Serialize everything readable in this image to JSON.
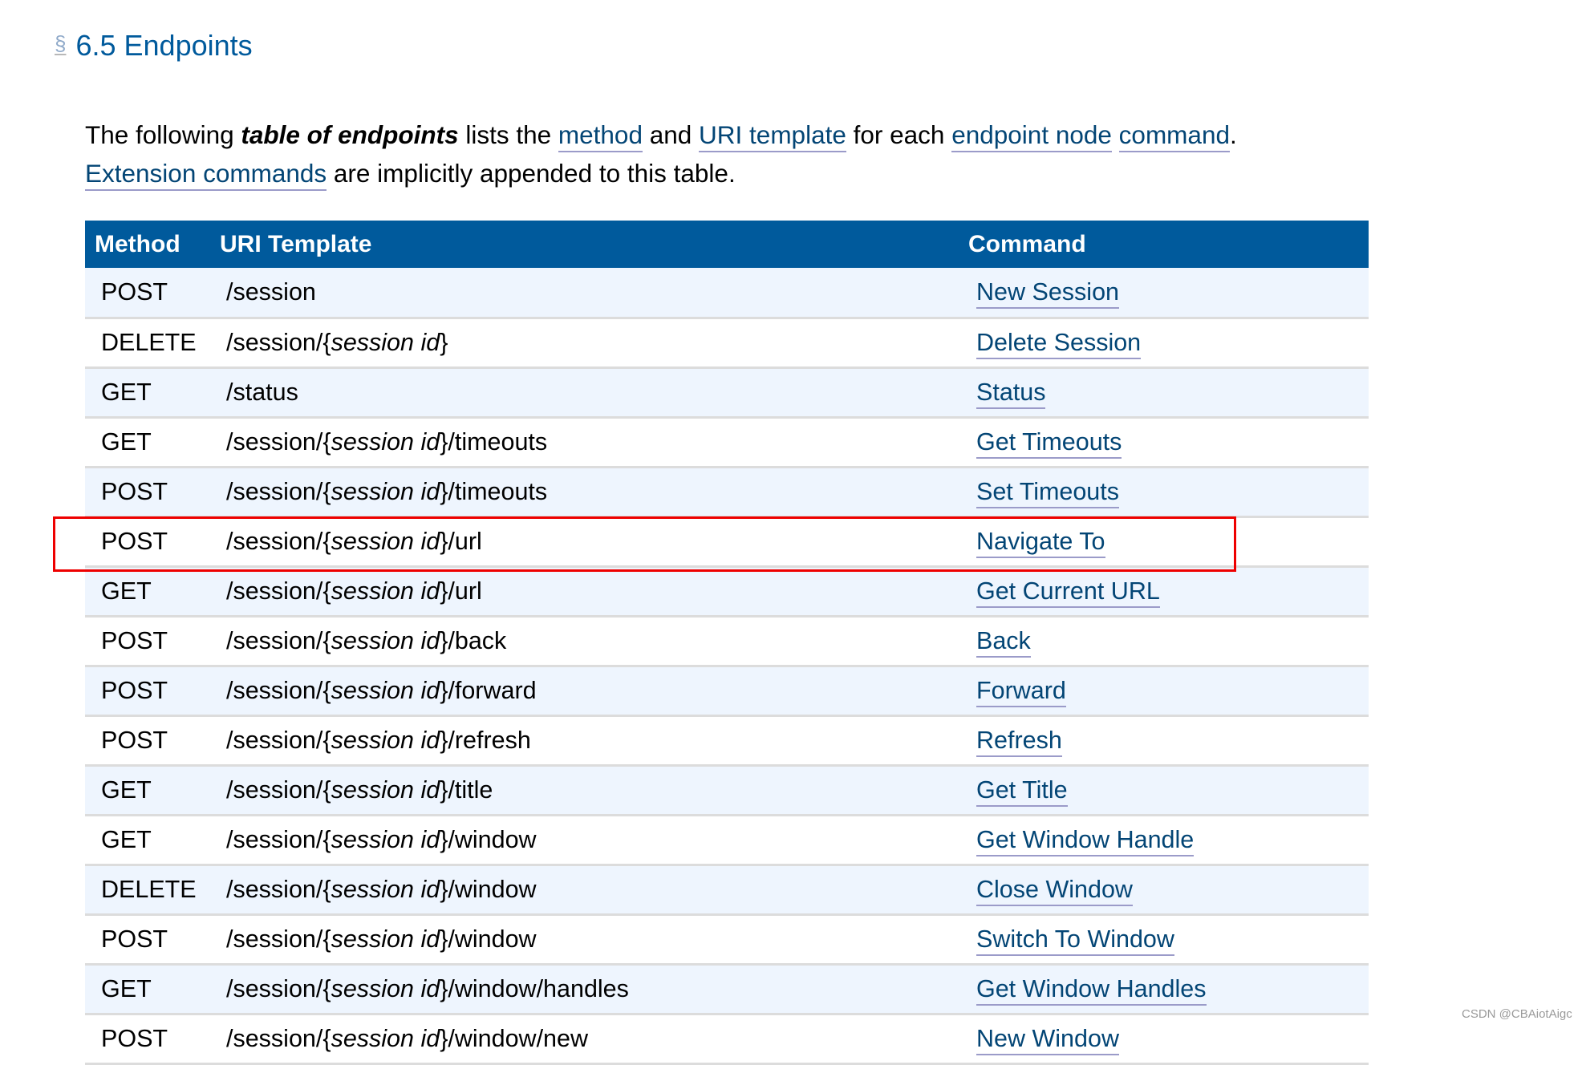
{
  "section": {
    "anchor_symbol": "§",
    "title": "6.5 Endpoints"
  },
  "intro": {
    "text_1": "The following ",
    "term": "table of endpoints",
    "text_2": " lists the ",
    "link_method": "method",
    "text_3": " and ",
    "link_uri_template": "URI template",
    "text_4": " for each ",
    "link_endpoint_node": "endpoint node",
    "text_5": " ",
    "link_command": "command",
    "text_6": ".",
    "link_extension_commands": "Extension commands",
    "text_7": " are implicitly appended to this table."
  },
  "table": {
    "headers": {
      "method": "Method",
      "uri_template": "URI Template",
      "command": "Command"
    },
    "rows": [
      {
        "method": "POST",
        "uri_prefix": "/session",
        "uri_var": "",
        "uri_suffix": "",
        "command": "New Session"
      },
      {
        "method": "DELETE",
        "uri_prefix": "/session/{",
        "uri_var": "session id",
        "uri_suffix": "}",
        "command": "Delete Session"
      },
      {
        "method": "GET",
        "uri_prefix": "/status",
        "uri_var": "",
        "uri_suffix": "",
        "command": "Status"
      },
      {
        "method": "GET",
        "uri_prefix": "/session/{",
        "uri_var": "session id",
        "uri_suffix": "}/timeouts",
        "command": "Get Timeouts"
      },
      {
        "method": "POST",
        "uri_prefix": "/session/{",
        "uri_var": "session id",
        "uri_suffix": "}/timeouts",
        "command": "Set Timeouts"
      },
      {
        "method": "POST",
        "uri_prefix": "/session/{",
        "uri_var": "session id",
        "uri_suffix": "}/url",
        "command": "Navigate To",
        "highlighted": true
      },
      {
        "method": "GET",
        "uri_prefix": "/session/{",
        "uri_var": "session id",
        "uri_suffix": "}/url",
        "command": "Get Current URL"
      },
      {
        "method": "POST",
        "uri_prefix": "/session/{",
        "uri_var": "session id",
        "uri_suffix": "}/back",
        "command": "Back"
      },
      {
        "method": "POST",
        "uri_prefix": "/session/{",
        "uri_var": "session id",
        "uri_suffix": "}/forward",
        "command": "Forward"
      },
      {
        "method": "POST",
        "uri_prefix": "/session/{",
        "uri_var": "session id",
        "uri_suffix": "}/refresh",
        "command": "Refresh"
      },
      {
        "method": "GET",
        "uri_prefix": "/session/{",
        "uri_var": "session id",
        "uri_suffix": "}/title",
        "command": "Get Title"
      },
      {
        "method": "GET",
        "uri_prefix": "/session/{",
        "uri_var": "session id",
        "uri_suffix": "}/window",
        "command": "Get Window Handle"
      },
      {
        "method": "DELETE",
        "uri_prefix": "/session/{",
        "uri_var": "session id",
        "uri_suffix": "}/window",
        "command": "Close Window"
      },
      {
        "method": "POST",
        "uri_prefix": "/session/{",
        "uri_var": "session id",
        "uri_suffix": "}/window",
        "command": "Switch To Window"
      },
      {
        "method": "GET",
        "uri_prefix": "/session/{",
        "uri_var": "session id",
        "uri_suffix": "}/window/handles",
        "command": "Get Window Handles"
      },
      {
        "method": "POST",
        "uri_prefix": "/session/{",
        "uri_var": "session id",
        "uri_suffix": "}/window/new",
        "command": "New Window"
      }
    ]
  },
  "colors": {
    "header_bg": "#005a9c",
    "heading_text": "#005a9c",
    "link_text": "#034575",
    "link_underline": "#9b9bc9",
    "row_alt_bg": "#eef5fe",
    "highlight_border": "#ee0000"
  },
  "watermark": "CSDN @CBAiotAigc"
}
